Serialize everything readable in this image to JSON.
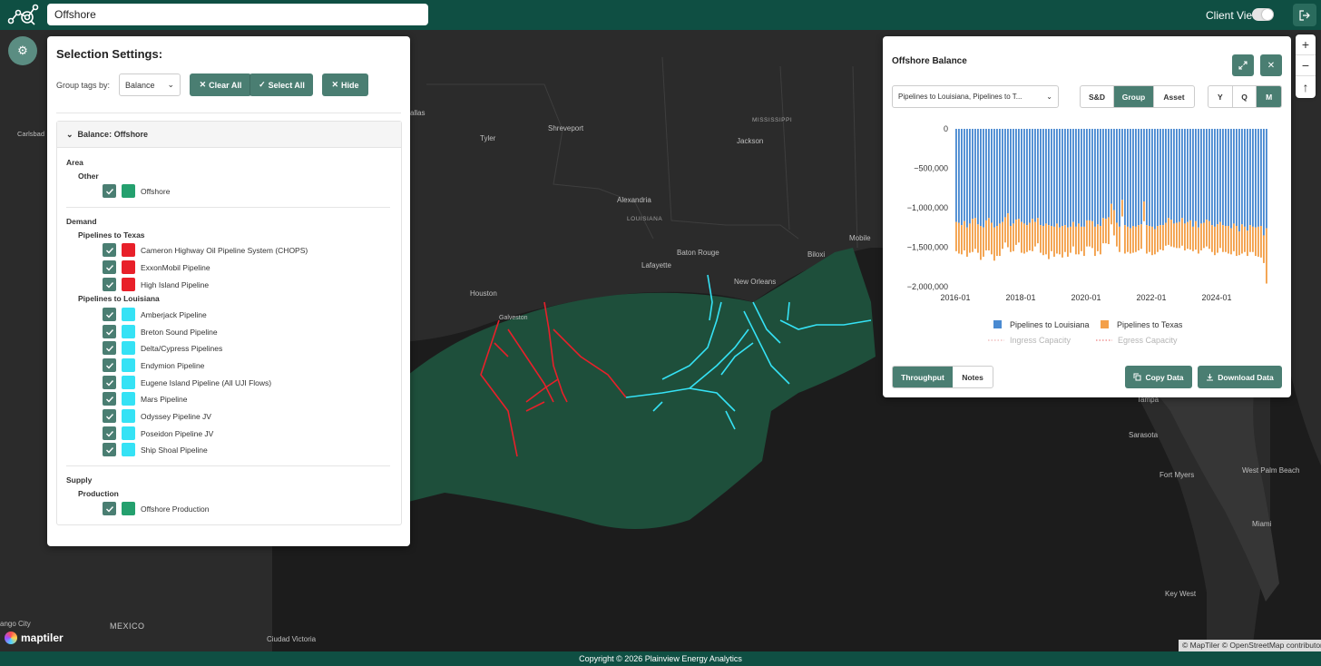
{
  "header": {
    "search_value": "Offshore",
    "client_view_label": "Client View",
    "client_view_on": true
  },
  "map": {
    "cities": [
      {
        "name": "Dallas",
        "text": "allas"
      },
      {
        "name": "Tyler",
        "text": "Tyler"
      },
      {
        "name": "Shreveport",
        "text": "Shreveport"
      },
      {
        "name": "Jackson",
        "text": "Jackson"
      },
      {
        "name": "Alexandria",
        "text": "Alexandria"
      },
      {
        "name": "Baton Rouge",
        "text": "Baton Rouge"
      },
      {
        "name": "Lafayette",
        "text": "Lafayette"
      },
      {
        "name": "Biloxi",
        "text": "Biloxi"
      },
      {
        "name": "Mobile",
        "text": "Mobile"
      },
      {
        "name": "New Orleans",
        "text": "New Orleans"
      },
      {
        "name": "Houston",
        "text": "Houston"
      },
      {
        "name": "Galveston",
        "text": "Galveston"
      },
      {
        "name": "Carlsbad",
        "text": "Carlsbad"
      },
      {
        "name": "Tampa",
        "text": "Tampa"
      },
      {
        "name": "Sarasota",
        "text": "Sarasota"
      },
      {
        "name": "Fort Myers",
        "text": "Fort Myers"
      },
      {
        "name": "West Palm Beach",
        "text": "West Palm Beach"
      },
      {
        "name": "Miami",
        "text": "Miami"
      },
      {
        "name": "Key West",
        "text": "Key West"
      },
      {
        "name": "Ciudad Victoria",
        "text": "Ciudad Victoria"
      },
      {
        "name": "Durango City",
        "text": "ango City"
      }
    ],
    "regions": [
      "MISSISSIPPI",
      "LOUISIANA"
    ],
    "country": "MEXICO",
    "attribution": "© MapTiler © OpenStreetMap contributors",
    "brand": "maptiler",
    "zoom_in": "+",
    "zoom_out": "−",
    "compass": "↑"
  },
  "colors": {
    "brand_green": "#0f4f43",
    "button_green": "#4a7e72",
    "offshore_area": "#1e4f3b",
    "texas_red": "#e8202a",
    "louisiana_cyan": "#35e2f5",
    "series_louisiana": "#4a8ad1",
    "series_texas": "#f3a04a"
  },
  "selection": {
    "title": "Selection Settings:",
    "group_by_label": "Group tags by:",
    "group_by_value": "Balance",
    "clear_all": "Clear All",
    "select_all": "Select All",
    "hide": "Hide",
    "accordion_title": "Balance: Offshore",
    "area_label": "Area",
    "area_other_label": "Other",
    "area_items": [
      {
        "label": "Offshore",
        "color": "#24a06e",
        "checked": true
      }
    ],
    "demand_label": "Demand",
    "texas_label": "Pipelines to Texas",
    "texas_items": [
      {
        "label": "Cameron Highway Oil Pipeline System (CHOPS)",
        "color": "#e8202a",
        "checked": true
      },
      {
        "label": "ExxonMobil Pipeline",
        "color": "#e8202a",
        "checked": true
      },
      {
        "label": "High Island Pipeline",
        "color": "#e8202a",
        "checked": true
      }
    ],
    "louisiana_label": "Pipelines to Louisiana",
    "louisiana_items": [
      {
        "label": "Amberjack Pipeline",
        "color": "#35e2f5",
        "checked": true
      },
      {
        "label": "Breton Sound Pipeline",
        "color": "#35e2f5",
        "checked": true
      },
      {
        "label": "Delta/Cypress Pipelines",
        "color": "#35e2f5",
        "checked": true
      },
      {
        "label": "Endymion Pipeline",
        "color": "#35e2f5",
        "checked": true
      },
      {
        "label": "Eugene Island Pipeline (All UJI Flows)",
        "color": "#35e2f5",
        "checked": true
      },
      {
        "label": "Mars Pipeline",
        "color": "#35e2f5",
        "checked": true
      },
      {
        "label": "Odyssey Pipeline JV",
        "color": "#35e2f5",
        "checked": true
      },
      {
        "label": "Poseidon Pipeline JV",
        "color": "#35e2f5",
        "checked": true
      },
      {
        "label": "Ship Shoal Pipeline",
        "color": "#35e2f5",
        "checked": true
      }
    ],
    "supply_label": "Supply",
    "production_label": "Production",
    "supply_items": [
      {
        "label": "Offshore Production",
        "color": "#24a06e",
        "checked": true
      }
    ]
  },
  "balance": {
    "title": "Offshore Balance",
    "filter_value": "Pipelines to Louisiana, Pipelines to T...",
    "view_modes": [
      "S&D",
      "Group",
      "Asset"
    ],
    "view_mode_active": "Group",
    "periods": [
      "Y",
      "Q",
      "M"
    ],
    "period_active": "M",
    "tabs": [
      "Throughput",
      "Notes"
    ],
    "tab_active": "Throughput",
    "copy_label": "Copy Data",
    "download_label": "Download Data",
    "icons": [
      "expand-icon",
      "close-icon",
      "copy-icon",
      "download-icon"
    ]
  },
  "chart_data": {
    "type": "bar",
    "stacked": true,
    "x_ticks": [
      "2016-01",
      "2018-01",
      "2020-01",
      "2022-01",
      "2024-01"
    ],
    "y_ticks": [
      "0",
      "−500,000",
      "−1,000,000",
      "−1,500,000",
      "−2,000,000"
    ],
    "ylim": [
      -2000000,
      0
    ],
    "x_range": [
      "2016-01",
      "2025-07"
    ],
    "frequency": "monthly",
    "grid": false,
    "legend_position": "bottom",
    "legend": [
      {
        "name": "Pipelines to Louisiana",
        "color": "#4a8ad1",
        "style": "square"
      },
      {
        "name": "Pipelines to Texas",
        "color": "#f3a04a",
        "style": "square"
      },
      {
        "name": "Ingress Capacity",
        "color": "#e8a0a0",
        "style": "dotted"
      },
      {
        "name": "Egress Capacity",
        "color": "#e86060",
        "style": "dotted"
      }
    ],
    "series": [
      {
        "name": "Pipelines to Louisiana",
        "color": "#4a8ad1",
        "values": [
          -1180000,
          -1190000,
          -1220000,
          -1170000,
          -1250000,
          -1200000,
          -1140000,
          -1130000,
          -1210000,
          -1230000,
          -1250000,
          -1160000,
          -1130000,
          -1190000,
          -1250000,
          -1230000,
          -1200000,
          -1180000,
          -1120000,
          -1070000,
          -1230000,
          -1200000,
          -1150000,
          -1140000,
          -1180000,
          -1200000,
          -1220000,
          -1190000,
          -1140000,
          -1180000,
          -1130000,
          -1220000,
          -1230000,
          -1200000,
          -1220000,
          -1230000,
          -1240000,
          -1200000,
          -1250000,
          -1230000,
          -1220000,
          -1250000,
          -1240000,
          -1180000,
          -1240000,
          -1200000,
          -1240000,
          -1240000,
          -1160000,
          -1160000,
          -1170000,
          -1240000,
          -1210000,
          -1230000,
          -1130000,
          -1140000,
          -1120000,
          -950000,
          -1030000,
          -1190000,
          -1240000,
          -900000,
          -1220000,
          -1240000,
          -1260000,
          -1230000,
          -1240000,
          -1220000,
          -1210000,
          -920000,
          -1220000,
          -1230000,
          -1240000,
          -1270000,
          -1230000,
          -1220000,
          -1220000,
          -1190000,
          -1130000,
          -1150000,
          -1200000,
          -1190000,
          -1180000,
          -1130000,
          -1200000,
          -1180000,
          -1160000,
          -1240000,
          -1170000,
          -1250000,
          -1200000,
          -1190000,
          -1150000,
          -1170000,
          -1220000,
          -1240000,
          -1210000,
          -1180000,
          -1220000,
          -1230000,
          -1230000,
          -1260000,
          -1200000,
          -1230000,
          -1300000,
          -1210000,
          -1240000,
          -1290000,
          -1220000,
          -1240000,
          -1250000,
          -1240000,
          -1230000,
          -1350000,
          -1260000
        ]
      },
      {
        "name": "Pipelines to Texas",
        "color": "#f3a04a",
        "values": [
          -370000,
          -390000,
          -370000,
          -370000,
          -370000,
          -370000,
          -420000,
          -390000,
          -360000,
          -430000,
          -370000,
          -380000,
          -410000,
          -400000,
          -420000,
          -380000,
          -410000,
          -340000,
          -320000,
          -430000,
          -330000,
          -350000,
          -320000,
          -300000,
          -390000,
          -380000,
          -340000,
          -350000,
          -410000,
          -310000,
          -320000,
          -350000,
          -370000,
          -390000,
          -430000,
          -320000,
          -380000,
          -380000,
          -340000,
          -400000,
          -340000,
          -370000,
          -330000,
          -310000,
          -350000,
          -390000,
          -310000,
          -370000,
          -330000,
          -330000,
          -340000,
          -370000,
          -340000,
          -360000,
          -320000,
          -310000,
          -340000,
          -260000,
          -320000,
          -300000,
          -320000,
          -210000,
          -360000,
          -320000,
          -320000,
          -340000,
          -320000,
          -320000,
          -310000,
          -250000,
          -360000,
          -330000,
          -360000,
          -320000,
          -330000,
          -310000,
          -320000,
          -290000,
          -340000,
          -340000,
          -300000,
          -320000,
          -330000,
          -350000,
          -340000,
          -340000,
          -370000,
          -310000,
          -360000,
          -330000,
          -340000,
          -320000,
          -340000,
          -350000,
          -340000,
          -360000,
          -360000,
          -330000,
          -340000,
          -330000,
          -350000,
          -330000,
          -350000,
          -380000,
          -300000,
          -370000,
          -320000,
          -320000,
          -340000,
          -320000,
          -360000,
          -380000,
          -400000,
          -350000,
          -700000
        ]
      }
    ]
  },
  "footer": {
    "copyright": "Copyright © 2026 Plainview Energy Analytics"
  }
}
